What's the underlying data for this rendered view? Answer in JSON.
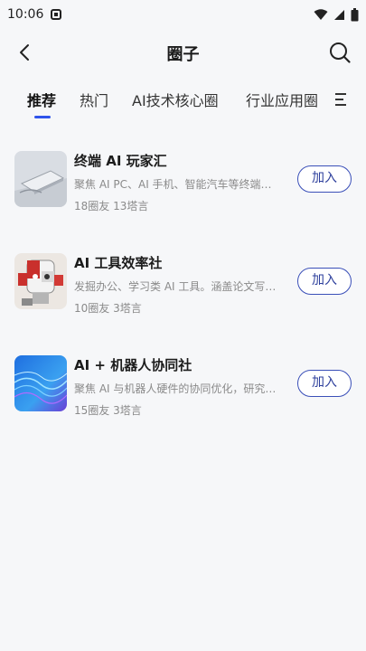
{
  "status_bar": {
    "time": "10:06"
  },
  "header": {
    "title": "圈子"
  },
  "tabs": [
    {
      "label": "推荐",
      "active": true
    },
    {
      "label": "热门",
      "active": false
    },
    {
      "label": "AI技术核心圈",
      "active": false
    },
    {
      "label": "行业应用圈",
      "active": false
    }
  ],
  "circles": [
    {
      "title": "终端 AI 玩家汇",
      "desc": "聚焦 AI PC、AI 手机、智能汽车等终端…",
      "meta": "18圈友 13塔言",
      "join_label": "加入"
    },
    {
      "title": "AI 工具效率社",
      "desc": "发掘办公、学习类 AI 工具。涵盖论文写…",
      "meta": "10圈友 3塔言",
      "join_label": "加入"
    },
    {
      "title": "AI + 机器人协同社",
      "desc": "聚焦 AI 与机器人硬件的协同优化，研究…",
      "meta": "15圈友 3塔言",
      "join_label": "加入"
    }
  ],
  "colors": {
    "accent": "#2f54eb",
    "button_border": "#3a4fb8",
    "background": "#f6f7f9"
  }
}
